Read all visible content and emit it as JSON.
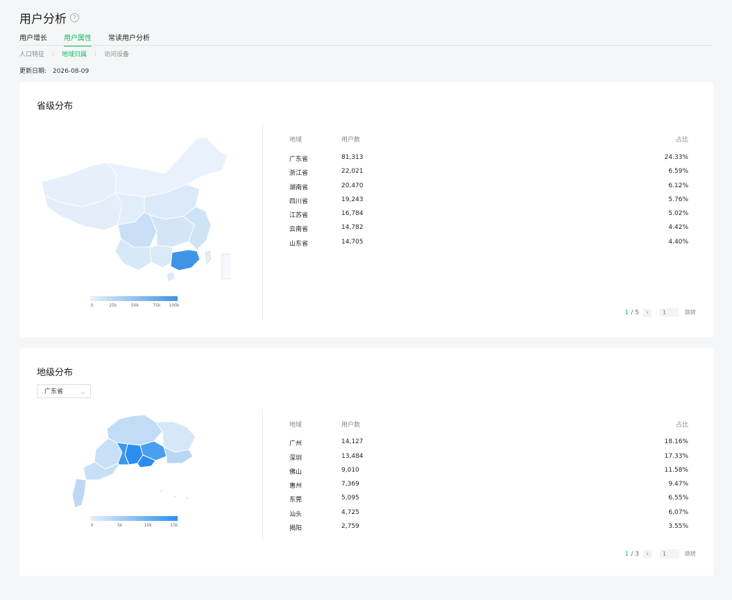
{
  "page": {
    "title": "用户分析",
    "help_icon": "question-circle-icon",
    "tabs": [
      {
        "label": "用户增长",
        "active": false
      },
      {
        "label": "用户属性",
        "active": true
      },
      {
        "label": "常读用户分析",
        "active": false
      }
    ],
    "subtabs": [
      {
        "label": "人口特征",
        "active": false
      },
      {
        "label": "地域归属",
        "active": true
      },
      {
        "label": "访问设备",
        "active": false
      }
    ],
    "update_label": "更新日期:",
    "update_date": "2026-08-09"
  },
  "colors": {
    "accent": "#07c160",
    "map_low": "#e6f0fb",
    "map_high": "#3f94e6",
    "city_high": "#2b8ff2"
  },
  "province": {
    "title": "省级分布",
    "columns": {
      "region": "地域",
      "users": "用户数",
      "ratio": "占比"
    },
    "rows": [
      {
        "region": "广东省",
        "users": "81,313",
        "ratio": "24.33%"
      },
      {
        "region": "浙江省",
        "users": "22,021",
        "ratio": "6.59%"
      },
      {
        "region": "湖南省",
        "users": "20,470",
        "ratio": "6.12%"
      },
      {
        "region": "四川省",
        "users": "19,243",
        "ratio": "5.76%"
      },
      {
        "region": "江苏省",
        "users": "16,784",
        "ratio": "5.02%"
      },
      {
        "region": "云南省",
        "users": "14,782",
        "ratio": "4.42%"
      },
      {
        "region": "山东省",
        "users": "14,705",
        "ratio": "4.40%"
      }
    ],
    "legend": [
      "0",
      "25k",
      "50k",
      "75k",
      "100k"
    ],
    "pager": {
      "current": "1",
      "total": "/ 5",
      "input_placeholder": "1",
      "jump": "跳转"
    }
  },
  "city": {
    "title": "地级分布",
    "select_value": "广东省",
    "columns": {
      "region": "地域",
      "users": "用户数",
      "ratio": "占比"
    },
    "rows": [
      {
        "region": "广州",
        "users": "14,127",
        "ratio": "18.16%"
      },
      {
        "region": "深圳",
        "users": "13,484",
        "ratio": "17.33%"
      },
      {
        "region": "佛山",
        "users": "9,010",
        "ratio": "11.58%"
      },
      {
        "region": "惠州",
        "users": "7,369",
        "ratio": "9.47%"
      },
      {
        "region": "东莞",
        "users": "5,095",
        "ratio": "6.55%"
      },
      {
        "region": "汕头",
        "users": "4,725",
        "ratio": "6.07%"
      },
      {
        "region": "揭阳",
        "users": "2,759",
        "ratio": "3.55%"
      }
    ],
    "legend": [
      "0",
      "5k",
      "10k",
      "15k"
    ],
    "pager": {
      "current": "1",
      "total": "/ 3",
      "input_placeholder": "1",
      "jump": "跳转"
    }
  }
}
